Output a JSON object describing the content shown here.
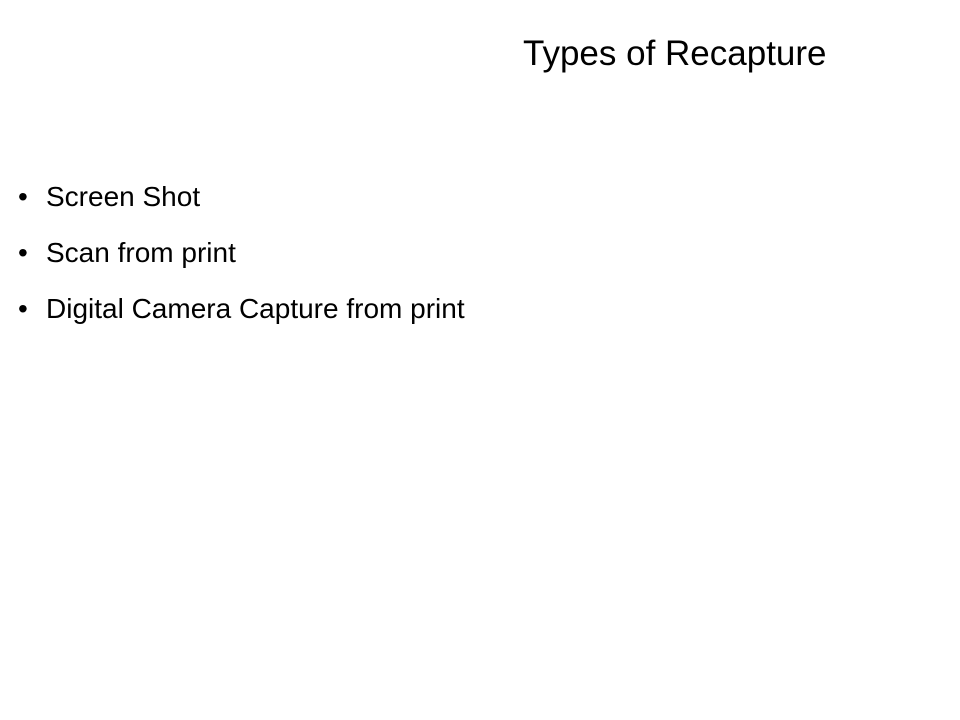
{
  "slide": {
    "title": "Types of Recapture",
    "bullet_symbol": "•",
    "bullets": [
      "Screen Shot",
      "Scan from print",
      "Digital Camera Capture from print"
    ]
  }
}
